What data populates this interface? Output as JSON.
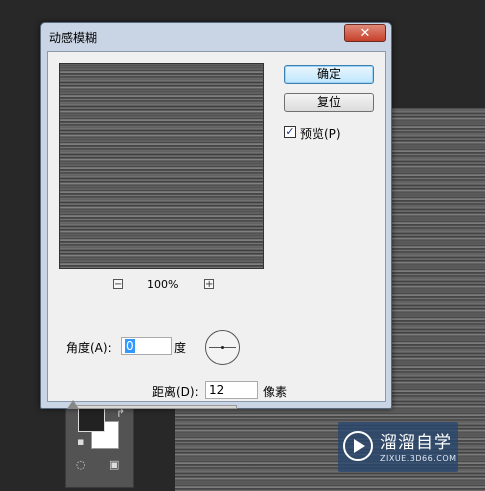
{
  "dialog": {
    "title": "动感模糊",
    "close_icon": "close-icon",
    "ok_label": "确定",
    "reset_label": "复位",
    "preview_label": "预览(P)",
    "preview_checked": true,
    "zoom_out_glyph": "−",
    "zoom_in_glyph": "+",
    "zoom_level": "100%",
    "angle_label": "角度(A):",
    "angle_value": "0",
    "angle_unit": "度",
    "distance_label": "距离(D):",
    "distance_value": "12",
    "distance_unit": "像素",
    "distance_slider_fraction": 0.02
  },
  "watermark": {
    "title": "溜溜自学",
    "subtitle": "ZIXUE.3D66.COM"
  },
  "colors": {
    "title_bar": "#c9d5e4",
    "close_button": "#c6402a",
    "selection": "#3399ff"
  }
}
